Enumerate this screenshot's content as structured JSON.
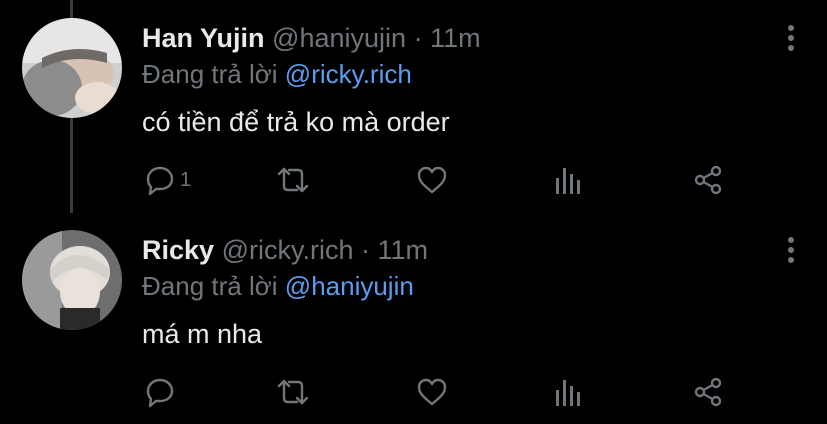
{
  "tweets": [
    {
      "name": "Han Yujin",
      "handle": "@haniyujin",
      "dot": "·",
      "time": "11m",
      "reply_prefix": "Đang trả lời",
      "reply_to": "@ricky.rich",
      "text": "có tiền để trả ko mà order",
      "reply_count": "1"
    },
    {
      "name": "Ricky",
      "handle": "@ricky.rich",
      "dot": "·",
      "time": "11m",
      "reply_prefix": "Đang trả lời",
      "reply_to": "@haniyujin",
      "text": "má m nha",
      "reply_count": ""
    }
  ],
  "icons": [
    "reply-icon",
    "retweet-icon",
    "like-icon",
    "analytics-icon",
    "share-icon",
    "more-icon"
  ],
  "colors": {
    "background": "#000000",
    "text": "#e7e9ea",
    "secondary": "#71767b",
    "mention": "#5b9ef0",
    "thread_line": "#3a3a3a"
  }
}
